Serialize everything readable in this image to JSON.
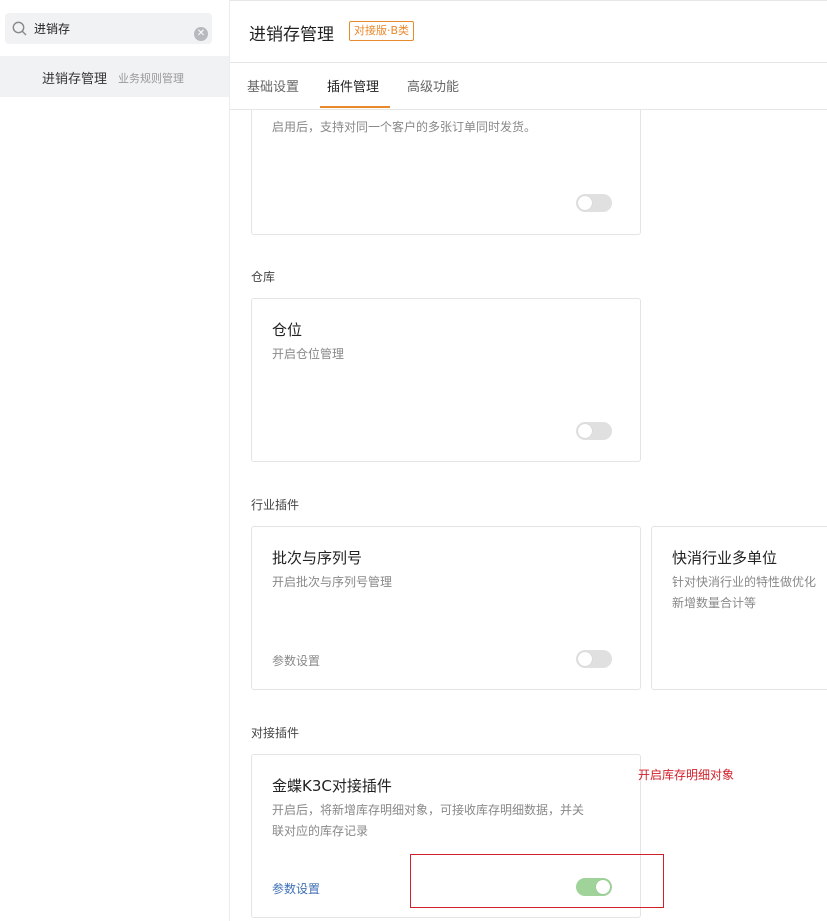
{
  "sidebar": {
    "search": {
      "value": "进销存",
      "placeholder": ""
    },
    "items": [
      {
        "label": "进销存管理",
        "sublabel": "业务规则管理"
      }
    ]
  },
  "header": {
    "title": "进销存管理",
    "badge": "对接版·B类"
  },
  "tabs": [
    {
      "label": "基础设置",
      "active": false
    },
    {
      "label": "插件管理",
      "active": true
    },
    {
      "label": "高级功能",
      "active": false
    }
  ],
  "cards": {
    "multi_order": {
      "desc": "启用后，支持对同一个客户的多张订单同时发货。",
      "enabled": false
    },
    "location": {
      "section": "仓库",
      "title": "仓位",
      "desc": "开启仓位管理",
      "enabled": false
    },
    "batch": {
      "section": "行业插件",
      "title": "批次与序列号",
      "desc": "开启批次与序列号管理",
      "link": "参数设置",
      "enabled": false
    },
    "fmcg": {
      "title": "快消行业多单位",
      "desc_line1": "针对快消行业的特性做优化",
      "desc_line2": "新增数量合计等"
    },
    "k3c": {
      "section": "对接插件",
      "title": "金蝶K3C对接插件",
      "desc_line1": "开启后，将新增库存明细对象，可接收库存明细数据，并关",
      "desc_line2": "联对应的库存记录",
      "link": "参数设置",
      "enabled": true
    }
  },
  "annotation": {
    "text": "开启库存明细对象",
    "color": "#d2202a"
  },
  "colors": {
    "accent": "#e8892c",
    "link": "#3d6fb4",
    "toggle_on": "#9fd39a",
    "toggle_off": "#e0e0e0"
  }
}
